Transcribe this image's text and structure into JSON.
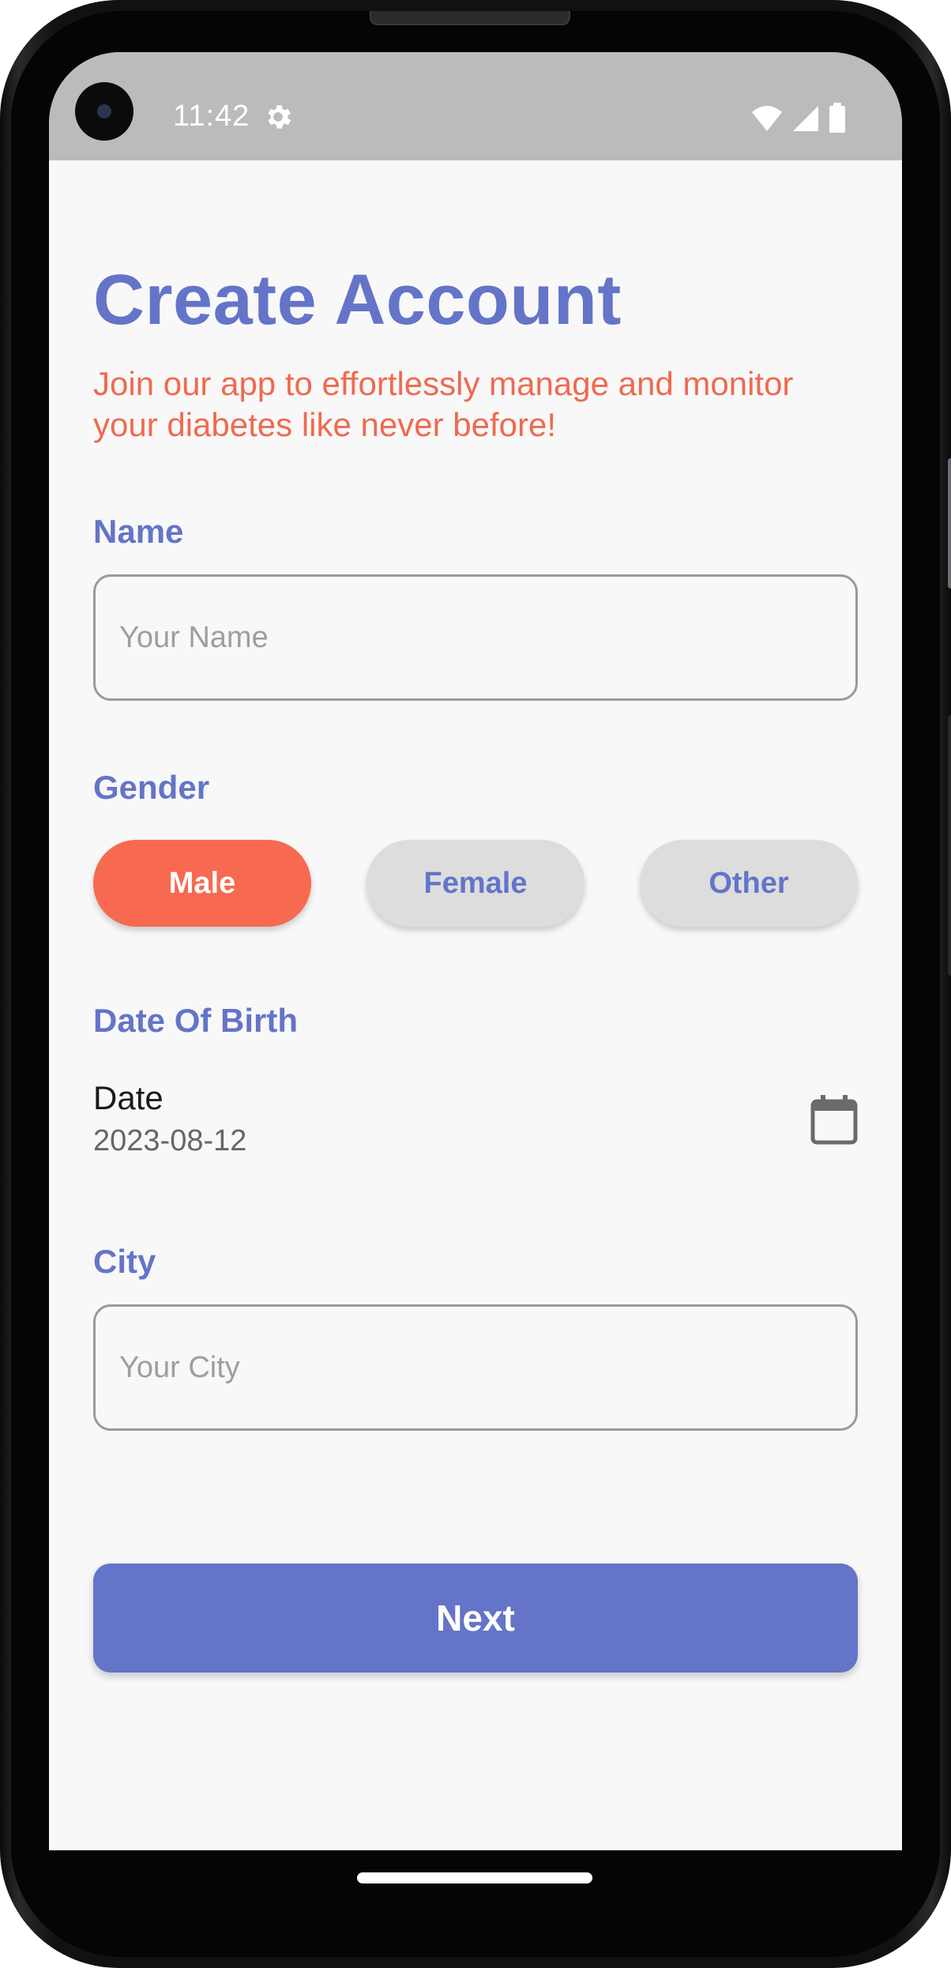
{
  "status_bar": {
    "time": "11:42",
    "icons": [
      "settings-gear-icon",
      "wifi-icon",
      "signal-icon",
      "battery-icon"
    ]
  },
  "header": {
    "title": "Create Account",
    "subtitle": "Join our app to effortlessly manage and monitor your diabetes like never before!"
  },
  "form": {
    "name": {
      "label": "Name",
      "placeholder": "Your Name",
      "value": ""
    },
    "gender": {
      "label": "Gender",
      "options": [
        "Male",
        "Female",
        "Other"
      ],
      "selected": "Male"
    },
    "dob": {
      "label": "Date Of Birth",
      "field_label": "Date",
      "value": "2023-08-12",
      "icon": "calendar-icon"
    },
    "city": {
      "label": "City",
      "placeholder": "Your City",
      "value": ""
    },
    "next_label": "Next"
  },
  "colors": {
    "primary": "#6474c8",
    "accent": "#f76a51",
    "subtitle": "#ef6a4f",
    "background": "#f8f8f8",
    "status_bar": "#bbbbbb"
  }
}
